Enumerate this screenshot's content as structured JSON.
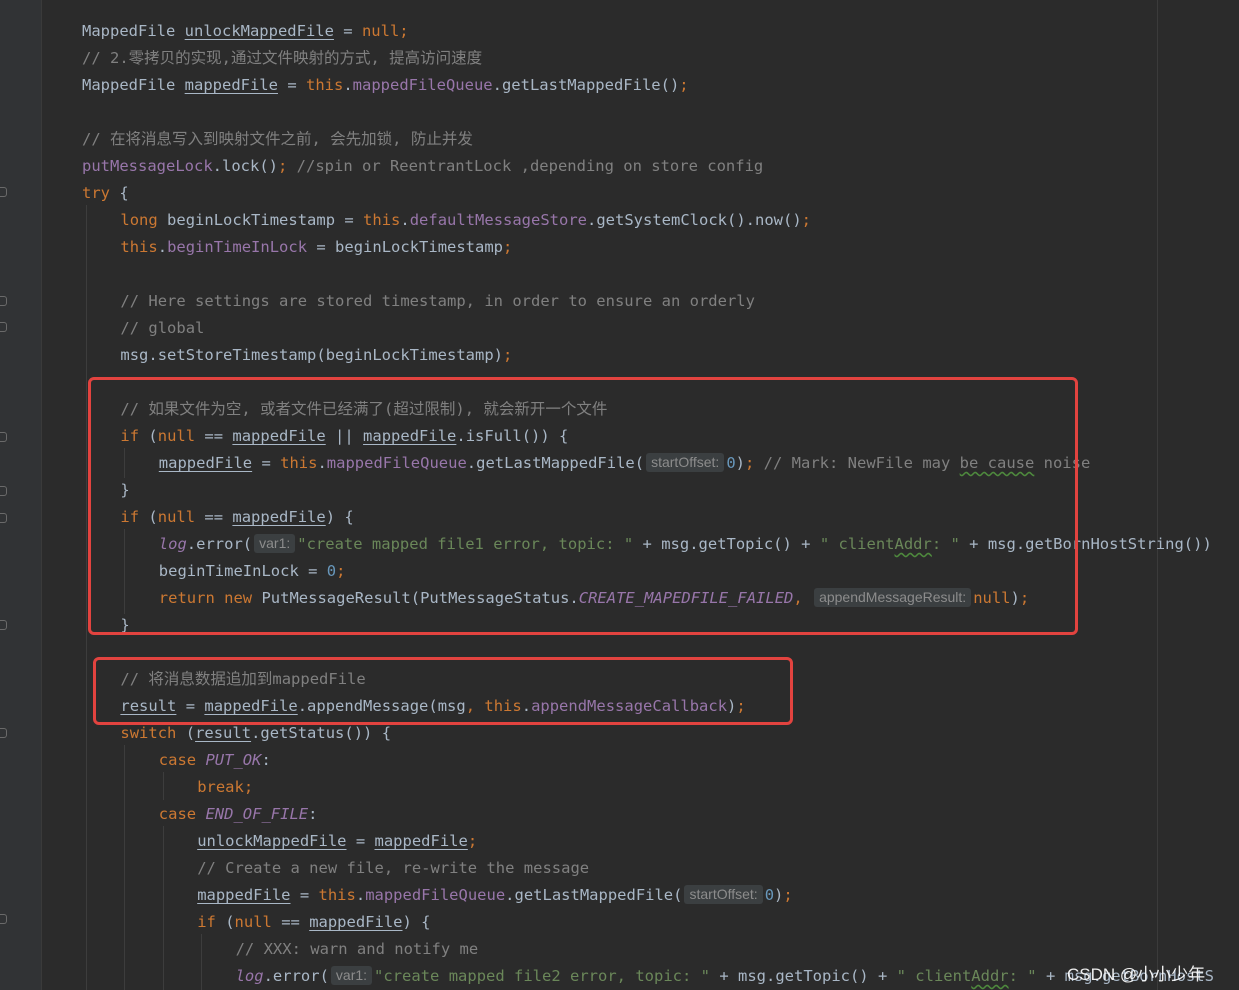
{
  "editor": {
    "language": "Java",
    "lines": [
      [
        [
          "t",
          "MappedFile "
        ],
        [
          "tu",
          "unlockMappedFile"
        ],
        [
          "t",
          " = "
        ],
        [
          "kw",
          "null"
        ],
        [
          "kw",
          ";"
        ]
      ],
      [
        [
          "c",
          "// 2.零拷贝的实现,通过文件映射的方式, 提高访问速度"
        ]
      ],
      [
        [
          "t",
          "MappedFile "
        ],
        [
          "tu",
          "mappedFile"
        ],
        [
          "t",
          " = "
        ],
        [
          "kw",
          "this"
        ],
        [
          "t",
          "."
        ],
        [
          "f",
          "mappedFileQueue"
        ],
        [
          "t",
          ".getLastMappedFile()"
        ],
        [
          "kw",
          ";"
        ]
      ],
      [],
      [
        [
          "c",
          "// 在将消息写入到映射文件之前, 会先加锁, 防止并发"
        ]
      ],
      [
        [
          "f",
          "putMessageLock"
        ],
        [
          "t",
          ".lock()"
        ],
        [
          "kw",
          ";"
        ],
        [
          "c",
          " //spin or ReentrantLock ,depending on store config"
        ]
      ],
      [
        [
          "kw",
          "try"
        ],
        [
          "t",
          " {"
        ]
      ],
      [
        [
          "kw",
          "long"
        ],
        [
          "t",
          " beginLockTimestamp = "
        ],
        [
          "kw",
          "this"
        ],
        [
          "t",
          "."
        ],
        [
          "f",
          "defaultMessageStore"
        ],
        [
          "t",
          ".getSystemClock().now()"
        ],
        [
          "kw",
          ";"
        ]
      ],
      [
        [
          "kw",
          "this"
        ],
        [
          "t",
          "."
        ],
        [
          "f",
          "beginTimeInLock"
        ],
        [
          "t",
          " = beginLockTimestamp"
        ],
        [
          "kw",
          ";"
        ]
      ],
      [],
      [
        [
          "c",
          "// Here settings are stored timestamp, in order to ensure an orderly"
        ]
      ],
      [
        [
          "c",
          "// global"
        ]
      ],
      [
        [
          "t",
          "msg.setStoreTimestamp(beginLockTimestamp)"
        ],
        [
          "kw",
          ";"
        ]
      ],
      [],
      [
        [
          "c",
          "// 如果文件为空, 或者文件已经满了(超过限制), 就会新开一个文件"
        ]
      ],
      [
        [
          "kw",
          "if"
        ],
        [
          "t",
          " ("
        ],
        [
          "kw",
          "null"
        ],
        [
          "t",
          " == "
        ],
        [
          "tu",
          "mappedFile"
        ],
        [
          "t",
          " || "
        ],
        [
          "tu",
          "mappedFile"
        ],
        [
          "t",
          ".isFull()) {"
        ]
      ],
      [
        [
          "tu",
          "mappedFile"
        ],
        [
          "t",
          " = "
        ],
        [
          "kw",
          "this"
        ],
        [
          "t",
          "."
        ],
        [
          "f",
          "mappedFileQueue"
        ],
        [
          "t",
          ".getLastMappedFile("
        ],
        [
          "hint",
          "startOffset:"
        ],
        [
          "n",
          "0"
        ],
        [
          "t",
          ")"
        ],
        [
          "kw",
          ";"
        ],
        [
          "c",
          " // Mark: NewFile may "
        ],
        [
          "cw",
          "be cause"
        ],
        [
          "c",
          " noise"
        ]
      ],
      [
        [
          "t",
          "}"
        ]
      ],
      [
        [
          "kw",
          "if"
        ],
        [
          "t",
          " ("
        ],
        [
          "kw",
          "null"
        ],
        [
          "t",
          " == "
        ],
        [
          "tu",
          "mappedFile"
        ],
        [
          "t",
          ") {"
        ]
      ],
      [
        [
          "fi",
          "log"
        ],
        [
          "t",
          ".error("
        ],
        [
          "hint",
          "var1:"
        ],
        [
          "s",
          "\"create mapped file1 error, topic: \""
        ],
        [
          "t",
          " + msg.getTopic() + "
        ],
        [
          "s",
          "\" client"
        ],
        [
          "sw",
          "Addr"
        ],
        [
          "s",
          ": \""
        ],
        [
          "t",
          " + msg.getBornHostString())"
        ]
      ],
      [
        [
          "t",
          "beginTimeInLock = "
        ],
        [
          "n",
          "0"
        ],
        [
          "kw",
          ";"
        ]
      ],
      [
        [
          "kw",
          "return new"
        ],
        [
          "t",
          " PutMessageResult(PutMessageStatus."
        ],
        [
          "sf",
          "CREATE_MAPEDFILE_FAILED"
        ],
        [
          "kw",
          ","
        ],
        [
          "t",
          " "
        ],
        [
          "hint",
          "appendMessageResult:"
        ],
        [
          "kw",
          "null"
        ],
        [
          "t",
          ")"
        ],
        [
          "kw",
          ";"
        ]
      ],
      [
        [
          "t",
          "}"
        ]
      ],
      [],
      [
        [
          "c",
          "// 将消息数据追加到mappedFile"
        ]
      ],
      [
        [
          "tu",
          "result"
        ],
        [
          "t",
          " = "
        ],
        [
          "tu",
          "mappedFile"
        ],
        [
          "t",
          ".appendMessage(msg"
        ],
        [
          "kw",
          ","
        ],
        [
          "t",
          " "
        ],
        [
          "kw",
          "this"
        ],
        [
          "t",
          "."
        ],
        [
          "f",
          "appendMessageCallback"
        ],
        [
          "t",
          ")"
        ],
        [
          "kw",
          ";"
        ]
      ],
      [
        [
          "kw",
          "switch"
        ],
        [
          "t",
          " ("
        ],
        [
          "tu",
          "result"
        ],
        [
          "t",
          ".getStatus()) {"
        ]
      ],
      [
        [
          "kw",
          "case"
        ],
        [
          "t",
          " "
        ],
        [
          "sf",
          "PUT_OK"
        ],
        [
          "t",
          ":"
        ]
      ],
      [
        [
          "kw",
          "break;"
        ]
      ],
      [
        [
          "kw",
          "case"
        ],
        [
          "t",
          " "
        ],
        [
          "sf",
          "END_OF_FILE"
        ],
        [
          "t",
          ":"
        ]
      ],
      [
        [
          "tu",
          "unlockMappedFile"
        ],
        [
          "t",
          " = "
        ],
        [
          "tu",
          "mappedFile"
        ],
        [
          "kw",
          ";"
        ]
      ],
      [
        [
          "c",
          "// Create a new file, re-write the message"
        ]
      ],
      [
        [
          "tu",
          "mappedFile"
        ],
        [
          "t",
          " = "
        ],
        [
          "kw",
          "this"
        ],
        [
          "t",
          "."
        ],
        [
          "f",
          "mappedFileQueue"
        ],
        [
          "t",
          ".getLastMappedFile("
        ],
        [
          "hint",
          "startOffset:"
        ],
        [
          "n",
          "0"
        ],
        [
          "t",
          ")"
        ],
        [
          "kw",
          ";"
        ]
      ],
      [
        [
          "kw",
          "if"
        ],
        [
          "t",
          " ("
        ],
        [
          "kw",
          "null"
        ],
        [
          "t",
          " == "
        ],
        [
          "tu",
          "mappedFile"
        ],
        [
          "t",
          ") {"
        ]
      ],
      [
        [
          "c",
          "// XXX: warn and notify me"
        ]
      ],
      [
        [
          "fi",
          "log"
        ],
        [
          "t",
          ".error("
        ],
        [
          "hint",
          "var1:"
        ],
        [
          "s",
          "\"create mapped file2 error, topic: \""
        ],
        [
          "t",
          " + msg.getTopic() + "
        ],
        [
          "s",
          "\" client"
        ],
        [
          "sw",
          "Addr"
        ],
        [
          "s",
          ": \""
        ],
        [
          "t",
          " + msg.getBornHostS"
        ]
      ]
    ]
  },
  "watermark": "CSDN @小小少年",
  "colors": {
    "background": "#2b2b2b",
    "gutter": "#313335",
    "text": "#a9b7c6",
    "keyword": "#cc7832",
    "field": "#9876aa",
    "string": "#6a8759",
    "number": "#6897bb",
    "comment": "#808080",
    "highlight_border": "#e2433f"
  }
}
